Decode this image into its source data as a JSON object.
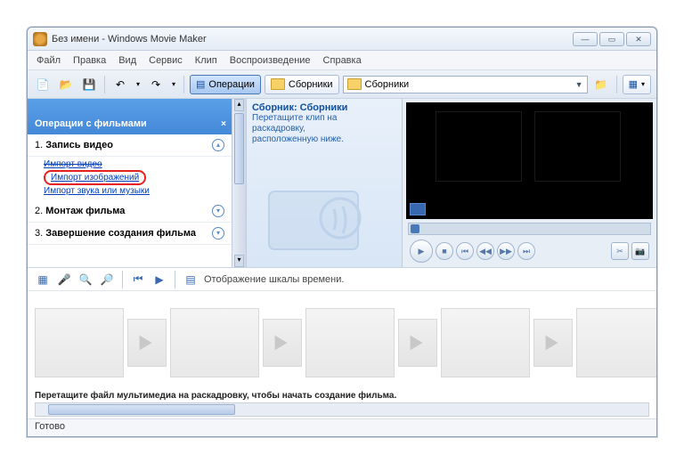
{
  "title": "Без имени - Windows Movie Maker",
  "menu": {
    "file": "Файл",
    "edit": "Правка",
    "view": "Вид",
    "service": "Сервис",
    "clip": "Клип",
    "play": "Воспроизведение",
    "help": "Справка"
  },
  "toolbar": {
    "operations": "Операции",
    "collections": "Сборники",
    "combo": "Сборники"
  },
  "tasks": {
    "header": "Операции с фильмами",
    "s1": {
      "num": "1.",
      "label": "Запись видео",
      "links": {
        "a": "Импорт видео",
        "b": "Импорт изображений",
        "c": "Импорт звука или музыки"
      }
    },
    "s2": {
      "num": "2.",
      "label": "Монтаж фильма"
    },
    "s3": {
      "num": "3.",
      "label": "Завершение создания фильма"
    }
  },
  "collection": {
    "title": "Сборник: Сборники",
    "sub1": "Перетащите клип на",
    "sub2": "раскадровку,",
    "sub3": "расположенную ниже."
  },
  "timeline": {
    "label": "Отображение шкалы времени.",
    "hint": "Перетащите файл мультимедиа на раскадровку, чтобы начать создание фильма."
  },
  "status": "Готово"
}
